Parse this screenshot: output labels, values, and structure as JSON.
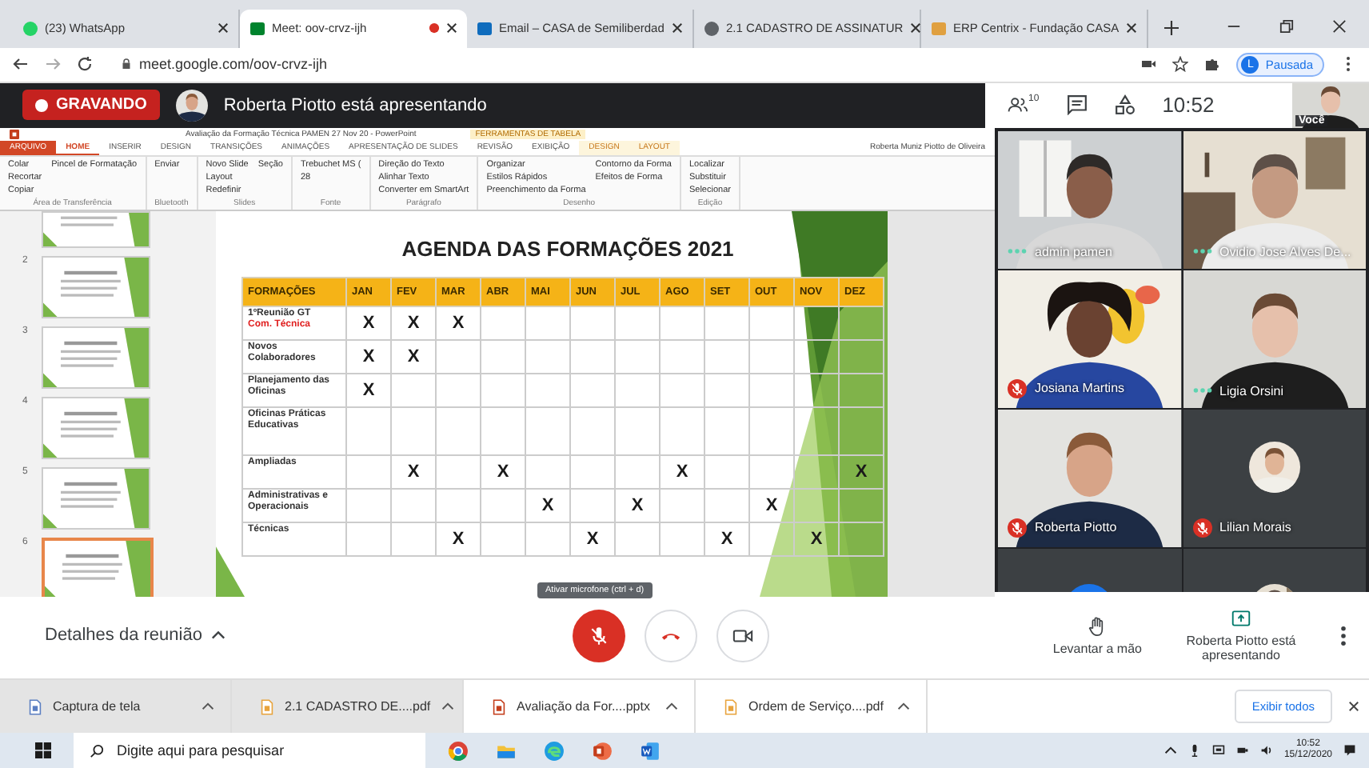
{
  "browser": {
    "tabs": [
      {
        "title": "(23) WhatsApp",
        "kind": "whatsapp",
        "selected": false,
        "recording": false
      },
      {
        "title": "Meet: oov-crvz-ijh",
        "kind": "meet",
        "selected": true,
        "recording": true
      },
      {
        "title": "Email – CASA de Semiliberdad",
        "kind": "mail",
        "selected": false,
        "recording": false
      },
      {
        "title": "2.1 CADASTRO DE ASSINATUR",
        "kind": "globe",
        "selected": false,
        "recording": false
      },
      {
        "title": "ERP Centrix - Fundação CASA",
        "kind": "erp",
        "selected": false,
        "recording": false
      }
    ],
    "address": "meet.google.com/oov-crvz-ijh",
    "profile": {
      "initial": "L",
      "status": "Pausada"
    }
  },
  "meet_bar": {
    "recording_label": "GRAVANDO",
    "presenter_text": "Roberta Piotto está apresentando",
    "people_count": "10",
    "time": "10:52",
    "self_label": "Você"
  },
  "presentation": {
    "app_title": "Avaliação da Formação Técnica PAMEN 27 Nov 20 - PowerPoint",
    "context_label": "FERRAMENTAS DE TABELA",
    "user_name": "Roberta Muniz Piotto de Oliveira",
    "ribbon_tabs": [
      {
        "label": "ARQUIVO",
        "kind": "file",
        "selected": false
      },
      {
        "label": "HOME",
        "kind": "normal",
        "selected": true
      },
      {
        "label": "INSERIR",
        "kind": "normal",
        "selected": false
      },
      {
        "label": "DESIGN",
        "kind": "normal",
        "selected": false
      },
      {
        "label": "TRANSIÇÕES",
        "kind": "normal",
        "selected": false
      },
      {
        "label": "ANIMAÇÕES",
        "kind": "normal",
        "selected": false
      },
      {
        "label": "APRESENTAÇÃO DE SLIDES",
        "kind": "normal",
        "selected": false
      },
      {
        "label": "REVISÃO",
        "kind": "normal",
        "selected": false
      },
      {
        "label": "EXIBIÇÃO",
        "kind": "normal",
        "selected": false
      },
      {
        "label": "DESIGN",
        "kind": "context",
        "selected": false
      },
      {
        "label": "LAYOUT",
        "kind": "context",
        "selected": false
      }
    ],
    "ribbon_groups": [
      {
        "label": "Área de Transferência",
        "items": [
          "Colar",
          "Recortar",
          "Copiar",
          "Pincel de Formatação"
        ]
      },
      {
        "label": "Bluetooth",
        "items": [
          "Enviar"
        ]
      },
      {
        "label": "Slides",
        "items": [
          "Novo Slide",
          "Layout",
          "Redefinir",
          "Seção"
        ]
      },
      {
        "label": "Fonte",
        "items": [
          "Trebuchet MS (",
          "28"
        ]
      },
      {
        "label": "Parágrafo",
        "items": [
          "Direção do Texto",
          "Alinhar Texto",
          "Converter em SmartArt"
        ]
      },
      {
        "label": "Desenho",
        "items": [
          "Organizar",
          "Estilos Rápidos",
          "Preenchimento da Forma",
          "Contorno da Forma",
          "Efeitos de Forma"
        ]
      },
      {
        "label": "Edição",
        "items": [
          "Localizar",
          "Substituir",
          "Selecionar"
        ]
      }
    ],
    "thumbnails": [
      {
        "selected": false
      },
      {
        "number": "2",
        "selected": false
      },
      {
        "number": "3",
        "selected": false
      },
      {
        "number": "4",
        "selected": false
      },
      {
        "number": "5",
        "selected": false
      },
      {
        "number": "6",
        "selected": true
      }
    ],
    "slide": {
      "title": "AGENDA DAS FORMAÇÕES 2021",
      "table": {
        "columns": [
          "FORMAÇÕES",
          "JAN",
          "FEV",
          "MAR",
          "ABR",
          "MAI",
          "JUN",
          "JUL",
          "AGO",
          "SET",
          "OUT",
          "NOV",
          "DEZ"
        ],
        "rows": [
          {
            "sublabel": "Com. Técnica",
            "cells": [
              "1ºReunião GT",
              "X",
              "X",
              "X",
              "",
              "",
              "",
              "",
              "",
              "",
              "",
              "",
              ""
            ]
          },
          {
            "cells": [
              "Novos Colaboradores",
              "X",
              "X",
              "",
              "",
              "",
              "",
              "",
              "",
              "",
              "",
              "",
              ""
            ]
          },
          {
            "cells": [
              "Planejamento das Oficinas",
              "X",
              "",
              "",
              "",
              "",
              "",
              "",
              "",
              "",
              "",
              "",
              ""
            ]
          },
          {
            "cells": [
              "Oficinas Práticas Educativas",
              "",
              "",
              "",
              "",
              "",
              "",
              "",
              "",
              "",
              "",
              "",
              ""
            ]
          },
          {
            "cells": [
              "Ampliadas",
              "",
              "X",
              "",
              "X",
              "",
              "",
              "",
              "X",
              "",
              "",
              "",
              "X"
            ]
          },
          {
            "cells": [
              "Administrativas e Operacionais",
              "",
              "",
              "",
              "",
              "X",
              "",
              "X",
              "",
              "",
              "X",
              "",
              ""
            ]
          },
          {
            "cells": [
              "Técnicas",
              "",
              "",
              "X",
              "",
              "",
              "X",
              "",
              "",
              "X",
              "",
              "X",
              ""
            ]
          }
        ]
      }
    }
  },
  "participants": [
    {
      "name": "admin pamen",
      "kind": "video",
      "muted": false
    },
    {
      "name": "Ovidio Jose Alves De...",
      "kind": "video",
      "muted": false
    },
    {
      "name": "Josiana Martins",
      "kind": "video",
      "muted": true
    },
    {
      "name": "Ligia Orsini",
      "kind": "video",
      "muted": false
    },
    {
      "name": "Roberta Piotto",
      "kind": "video",
      "muted": true
    },
    {
      "name": "Lilian Morais",
      "kind": "avatar",
      "muted": true
    }
  ],
  "controls": {
    "details_label": "Detalhes da reunião",
    "mic_muted": true,
    "mic_tooltip": "Ativar microfone (ctrl + d)",
    "raise_hand": "Levantar a mão",
    "presenting": "Roberta Piotto está apresentando"
  },
  "downloads": {
    "items": [
      {
        "name": "Captura de tela"
      },
      {
        "name": "2.1 CADASTRO DE....pdf",
        "kind": "pdf"
      },
      {
        "name": "Avaliação da For....pptx",
        "kind": "pptx"
      },
      {
        "name": "Ordem de Serviço....pdf",
        "kind": "pdf"
      }
    ],
    "show_all": "Exibir todos"
  },
  "taskbar": {
    "search_placeholder": "Digite aqui para pesquisar",
    "time": "10:52",
    "date": "15/12/2020"
  }
}
